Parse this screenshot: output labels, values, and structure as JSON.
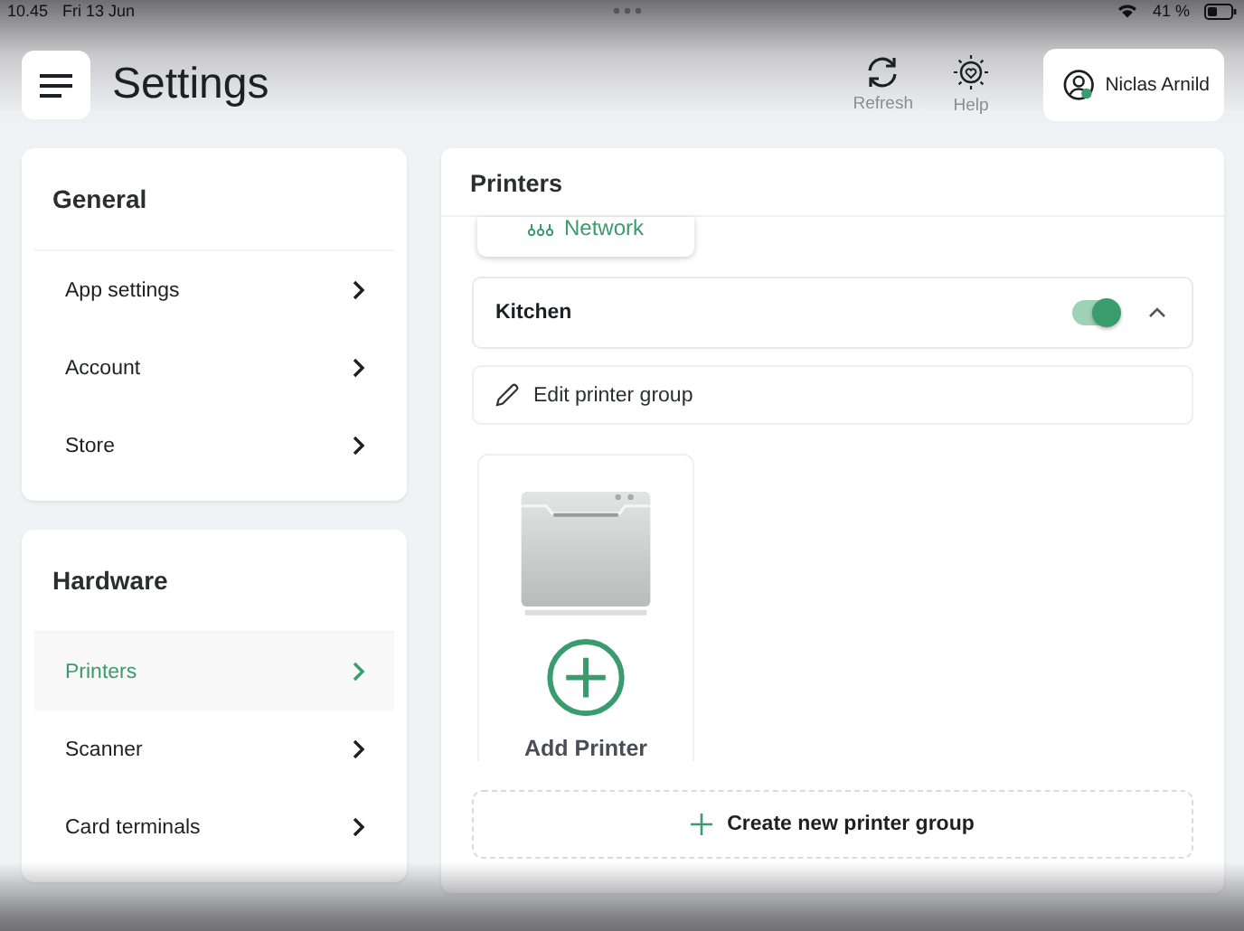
{
  "status_bar": {
    "time": "10.45",
    "date": "Fri 13 Jun",
    "battery": "41 %"
  },
  "header": {
    "title": "Settings",
    "actions": [
      {
        "kind": "refresh",
        "label": "Refresh"
      },
      {
        "kind": "help",
        "label": "Help"
      }
    ],
    "user": {
      "name": "Niclas Arnild",
      "online": true
    }
  },
  "sidebar": [
    {
      "title": "General",
      "items": [
        {
          "label": "App settings",
          "selected": false
        },
        {
          "label": "Account",
          "selected": false
        },
        {
          "label": "Store",
          "selected": false
        }
      ]
    },
    {
      "title": "Hardware",
      "items": [
        {
          "label": "Printers",
          "selected": true
        },
        {
          "label": "Scanner",
          "selected": false
        },
        {
          "label": "Card terminals",
          "selected": false
        }
      ]
    }
  ],
  "panel": {
    "title": "Printers",
    "connection": "Network",
    "group": {
      "name": "Kitchen",
      "enabled": true,
      "expanded": true
    },
    "edit_label": "Edit printer group",
    "add_printer_label": "Add Printer",
    "create_label": "Create new printer group"
  }
}
